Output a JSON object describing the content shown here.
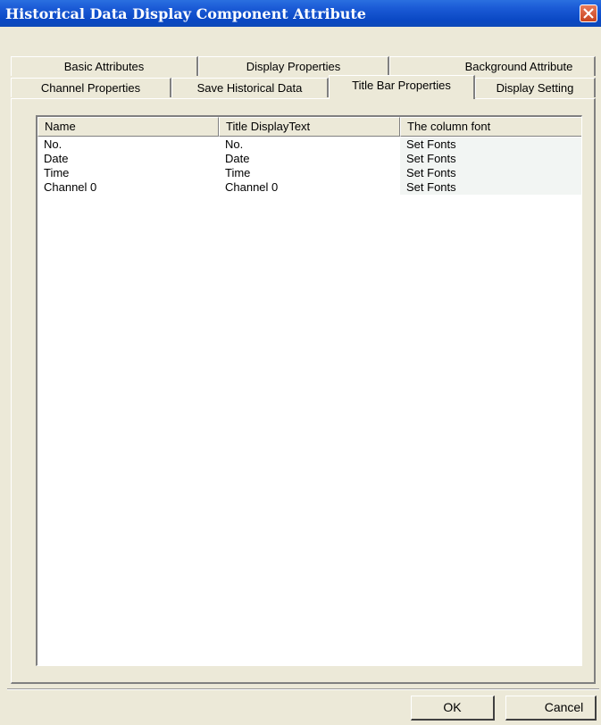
{
  "window": {
    "title": "Historical Data Display Component Attribute"
  },
  "tabs": {
    "row1": [
      "Basic Attributes",
      "Display Properties",
      "Background Attribute"
    ],
    "row2": [
      "Channel Properties",
      "Save Historical Data",
      "Title Bar Properties",
      "Display Setting"
    ],
    "active": "Title Bar Properties"
  },
  "list": {
    "columns": [
      "Name",
      "Title DisplayText",
      "The column font"
    ],
    "rows": [
      [
        "No.",
        "No.",
        "Set Fonts"
      ],
      [
        "Date",
        "Date",
        "Set Fonts"
      ],
      [
        "Time",
        "Time",
        "Set Fonts"
      ],
      [
        "Channel 0",
        "Channel 0",
        "Set Fonts"
      ]
    ]
  },
  "buttons": {
    "ok": "OK",
    "cancel": "Cancel"
  },
  "icons": {
    "close": "close-icon"
  },
  "colors": {
    "titlebar": "#0a48c4",
    "close": "#c8431e",
    "dialog": "#ece9d8"
  }
}
